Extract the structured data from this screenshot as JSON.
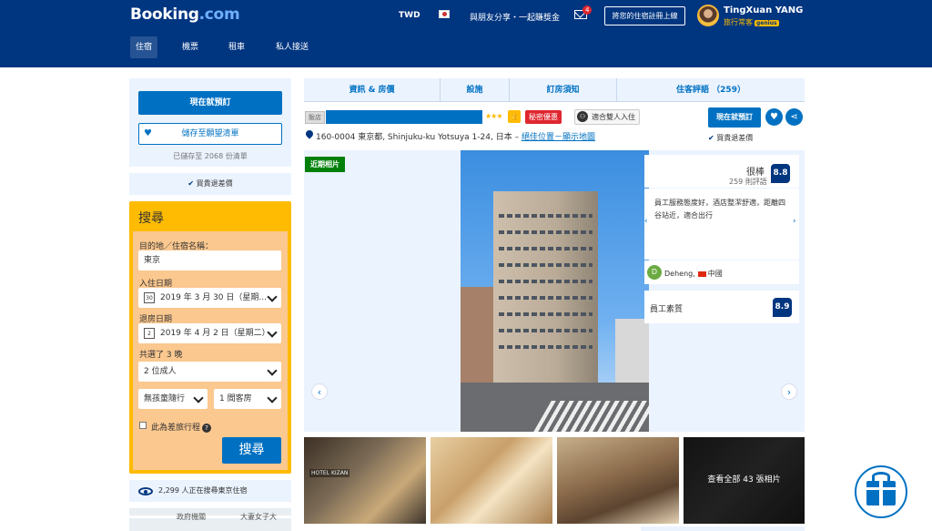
{
  "header": {
    "logo_main": "Booking",
    "logo_dot": ".com",
    "currency": "TWD",
    "share": "與朋友分享・一起賺獎金",
    "mail_count": "4",
    "list_property": "將您的住宿註冊上線",
    "user_name": "TingXuan YANG",
    "user_status": "旅行常客",
    "genius": "genius",
    "nav": [
      "住宿",
      "機票",
      "租車",
      "私人接送"
    ]
  },
  "sidebar": {
    "book_now": "現在就預訂",
    "save_list": "儲存至願望清單",
    "saved_count": "已儲存至 2068 份清單",
    "price_match": "買貴退差價",
    "search": {
      "title": "搜尋",
      "destination_label": "目的地／住宿名稱：",
      "destination_value": "東京",
      "checkin_label": "入住日期",
      "checkin_cal": "30",
      "checkin_value": "2019 年 3 月 30 日（星期...",
      "checkout_label": "退房日期",
      "checkout_cal": "2",
      "checkout_value": "2019 年 4 月 2 日（星期二）",
      "nights": "共選了 3 晚",
      "adults": "2 位成人",
      "children": "無孩童隨行",
      "rooms": "1 間客房",
      "business_trip": "此為差旅行程",
      "submit": "搜尋"
    },
    "watchers": "2,299 人正在搜尋東京住宿",
    "map_labels": [
      "政府機關",
      "大妻女子大"
    ]
  },
  "tabs": [
    "資訊 & 房價",
    "設施",
    "訂房須知",
    "住客評語 （259）"
  ],
  "hotel": {
    "type": "飯店",
    "stars": "★★★",
    "thumb": "👍",
    "secret_deal": "秘密優惠",
    "couple": "適合雙人入住",
    "address": "160-0004 東京都, Shinjuku-ku Yotsuya 1-24, 日本 –",
    "address_link": "絕佳位置－顯示地圖",
    "reserve": "現在就預訂",
    "price_match": "買貴退差價"
  },
  "gallery": {
    "recent_tag": "近期相片",
    "prev": "‹",
    "next": "›",
    "view_all": "查看全部 43 張相片",
    "hotel_sign": "HOTEL KIZAN"
  },
  "review": {
    "rating_word": "很棒",
    "count": "259 則評語",
    "score": "8.8",
    "text": "員工服務態度好，酒店整潔舒適，距離四谷站近，適合出行",
    "prev": "‹",
    "next": "›",
    "reviewer_initial": "D",
    "reviewer_name": "Deheng,",
    "reviewer_country": "中國",
    "staff_label": "員工素質",
    "staff_score": "8.9"
  },
  "colors": {
    "header_bg": "#003580",
    "primary": "#0071c2",
    "search_bg": "#febb02",
    "secret": "#e0262f",
    "recent": "#008009"
  }
}
